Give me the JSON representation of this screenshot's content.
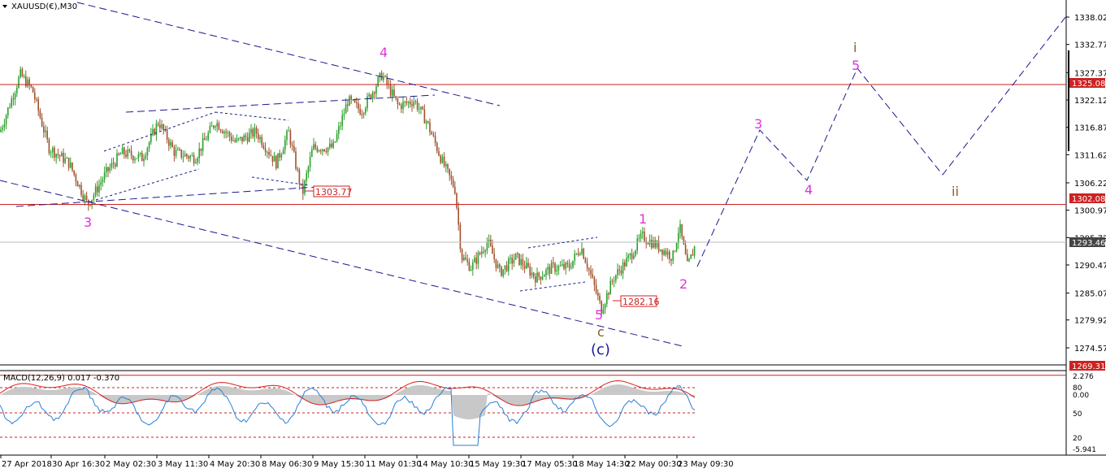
{
  "window": {
    "title": "XAUUSD(€),M30",
    "menu_icon": "triangle-down-icon"
  },
  "colors": {
    "bull": "#2ca02c",
    "bear": "#a0522d",
    "wave_magenta": "#e033e0",
    "wave_brown": "#8b5a2b",
    "wave_blue": "#1a1aa0",
    "hline_red": "#cc2222",
    "trend_navy": "#1a1a8c",
    "macd_hist": "#c8c8c8",
    "macd_signal": "#d62020",
    "stoch": "#2a7fd4",
    "level_box": "#cc2222"
  },
  "price_axis": {
    "ticks": [
      "1338.02",
      "1332.77",
      "1327.37",
      "1322.12",
      "1316.87",
      "1311.62",
      "1306.22",
      "1300.97",
      "1295.72",
      "1290.47",
      "1285.07",
      "1279.92",
      "1274.57"
    ],
    "current": "1293.46"
  },
  "levels": [
    {
      "label": "1325.08",
      "price": 1325.08
    },
    {
      "label": "1302.08",
      "price": 1302.08
    },
    {
      "label": "1269.31",
      "price": 1269.31
    }
  ],
  "level_labels": [
    {
      "label": "1303.77"
    },
    {
      "label": "1282.16"
    }
  ],
  "time_axis": [
    "27 Apr 2018",
    "30 Apr 16:30",
    "2 May 02:30",
    "3 May 11:30",
    "4 May 20:30",
    "8 May 06:30",
    "9 May 15:30",
    "11 May 01:30",
    "14 May 10:30",
    "15 May 19:30",
    "17 May 05:30",
    "18 May 14:30",
    "22 May 00:30",
    "23 May 09:30"
  ],
  "wave_labels": {
    "w3_left": "3",
    "w4_top": "4",
    "w5_bottom": "5",
    "wc": "c",
    "wc_paren": "(c)",
    "w1": "1",
    "w2": "2",
    "w3_proj": "3",
    "w4_proj": "4",
    "w5_proj": "5",
    "wi": "i",
    "wii": "ii"
  },
  "macd": {
    "header": "MACD(12,26,9) 0.017 -0.370",
    "axis": [
      "2.276",
      "80",
      "0.00",
      "50",
      "20",
      "-5.941"
    ]
  }
}
